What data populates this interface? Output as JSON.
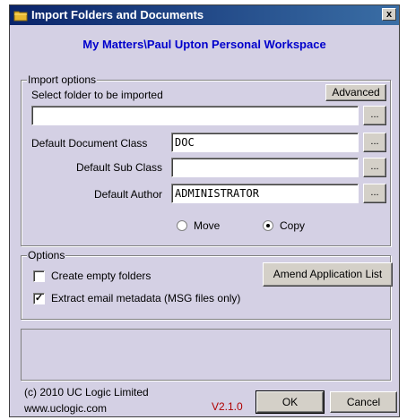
{
  "window": {
    "title": "Import Folders and Documents",
    "close_label": "x"
  },
  "workspace_path": "My Matters\\Paul Upton Personal Workspace",
  "import_options": {
    "group_label": "Import options",
    "select_folder_label": "Select folder to be imported",
    "advanced_label": "Advanced",
    "folder_value": "",
    "browse_label": "...",
    "doc_class_label": "Default Document Class",
    "doc_class_value": "DOC",
    "sub_class_label": "Default Sub Class",
    "sub_class_value": "",
    "author_label": "Default Author",
    "author_value": "ADMINISTRATOR",
    "move_label": "Move",
    "copy_label": "Copy",
    "selected_mode": "Copy"
  },
  "options": {
    "group_label": "Options",
    "create_empty_label": "Create empty folders",
    "create_empty_checked": false,
    "extract_email_label": "Extract email metadata (MSG files only)",
    "extract_email_checked": true,
    "check_mark": "✓",
    "amend_label": "Amend Application List"
  },
  "footer": {
    "copyright": "(c) 2010 UC Logic Limited",
    "website": "www.uclogic.com",
    "version": "V2.1.0",
    "ok_label": "OK",
    "cancel_label": "Cancel"
  },
  "colors": {
    "title_start": "#0A246A",
    "title_end": "#3A6EA5",
    "dialog_bg": "#D4D0E4",
    "subtitle": "#0000CC",
    "version": "#B00000"
  }
}
